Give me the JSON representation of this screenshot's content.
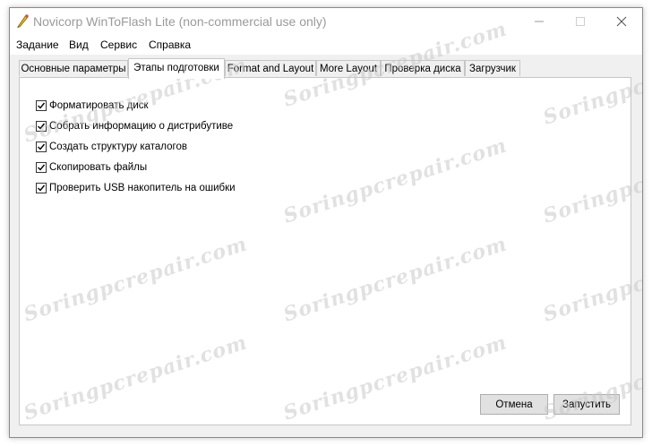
{
  "window": {
    "title": "Novicorp WinToFlash Lite (non-commercial use only)",
    "icon": "pencil-icon",
    "controls": [
      "minimize-icon",
      "maximize-icon",
      "close-icon"
    ]
  },
  "menu": {
    "items": [
      "Задание",
      "Вид",
      "Сервис",
      "Справка"
    ]
  },
  "tabs": [
    {
      "label": "Основные параметры",
      "active": false
    },
    {
      "label": "Этапы подготовки",
      "active": true
    },
    {
      "label": "Format and Layout",
      "active": false
    },
    {
      "label": "More Layout",
      "active": false
    },
    {
      "label": "Проверка диска",
      "active": false
    },
    {
      "label": "Загрузчик",
      "active": false
    }
  ],
  "steps": [
    {
      "label": "Форматировать диск",
      "checked": true
    },
    {
      "label": "Собрать информацию о дистрибутиве",
      "checked": true
    },
    {
      "label": "Создать структуру каталогов",
      "checked": true
    },
    {
      "label": "Скопировать файлы",
      "checked": true
    },
    {
      "label": "Проверить USB накопитель на ошибки",
      "checked": true
    }
  ],
  "buttons": {
    "cancel": "Отмена",
    "start": "Запустить"
  },
  "watermark": "Soringpcrepair.com"
}
